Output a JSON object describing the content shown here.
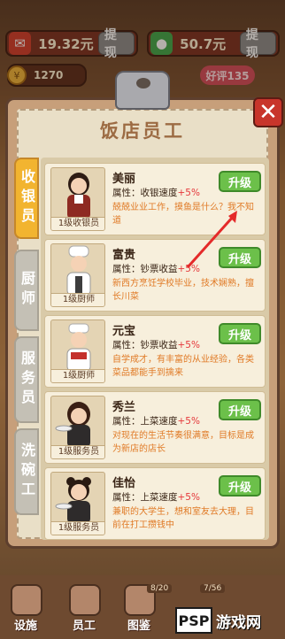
{
  "top": {
    "cash_value": "19.32元",
    "cash_withdraw": "提现",
    "wechat_value": "50.7元",
    "wechat_withdraw": "提现",
    "coins": "1270",
    "review": "好评135"
  },
  "panel": {
    "title": "饭店员工",
    "close_glyph": "✕"
  },
  "tabs": [
    {
      "label": "收银员",
      "active": true
    },
    {
      "label": "厨师",
      "active": false
    },
    {
      "label": "服务员",
      "active": false
    },
    {
      "label": "洗碗工",
      "active": false
    }
  ],
  "staff": [
    {
      "name": "美丽",
      "attr_label": "属性：收银速度",
      "bonus": "+5%",
      "desc": "兢兢业业工作，摸鱼是什么？我不知道",
      "level": "1级收银员",
      "button": "升级"
    },
    {
      "name": "富贵",
      "attr_label": "属性：钞票收益",
      "bonus": "+5%",
      "desc": "新西方烹饪学校毕业，技术娴熟，擅长川菜",
      "level": "1级厨师",
      "button": "升级"
    },
    {
      "name": "元宝",
      "attr_label": "属性：钞票收益",
      "bonus": "+5%",
      "desc": "自学成才，有丰富的从业经验，各类菜品都能手到擒来",
      "level": "1级厨师",
      "button": "升级"
    },
    {
      "name": "秀兰",
      "attr_label": "属性：上菜速度",
      "bonus": "+5%",
      "desc": "对现在的生活节奏很满意，目标是成为新店的店长",
      "level": "1级服务员",
      "button": "升级"
    },
    {
      "name": "佳怡",
      "attr_label": "属性：上菜速度",
      "bonus": "+5%",
      "desc": "兼职的大学生，想和室友去大理，目前在打工攒钱中",
      "level": "1级服务员",
      "button": "升级"
    }
  ],
  "nav": [
    {
      "label": "设施"
    },
    {
      "label": "员工"
    },
    {
      "label": "图鉴"
    }
  ],
  "nav_counts": [
    "8/20",
    "7/56"
  ],
  "watermark": {
    "badge": "PSP",
    "text": "游戏网"
  }
}
